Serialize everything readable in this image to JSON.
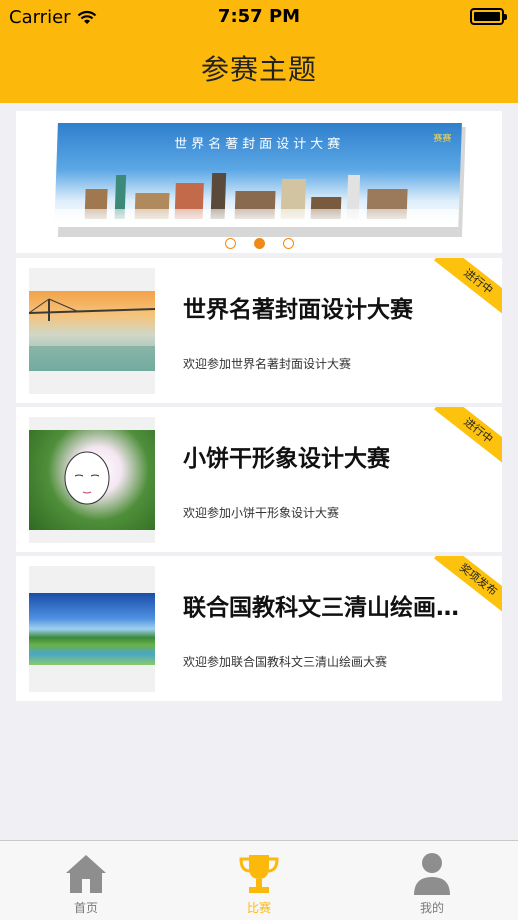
{
  "status": {
    "carrier": "Carrier",
    "time": "7:57 PM"
  },
  "nav": {
    "title": "参赛主题"
  },
  "colors": {
    "accent": "#fcb90c",
    "dot": "#f08a16",
    "background": "#efeff4"
  },
  "banner": {
    "title": "世界名著封面设计大赛",
    "tag": "赛赛",
    "slide_index": 2,
    "slide_count": 3
  },
  "contests": [
    {
      "title": "世界名著封面设计大赛",
      "desc": "欢迎参加世界名著封面设计大赛",
      "status": "进行中",
      "image": "bridge-sunset"
    },
    {
      "title": "小饼干形象设计大赛",
      "desc": "欢迎参加小饼干形象设计大赛",
      "status": "进行中",
      "image": "leaf-girl"
    },
    {
      "title": "联合国教科文三清山绘画…",
      "desc": "欢迎参加联合国教科文三清山绘画大赛",
      "status": "奖项发布",
      "image": "lake-landscape"
    }
  ],
  "tabs": [
    {
      "label": "首页",
      "icon": "home-icon"
    },
    {
      "label": "比赛",
      "icon": "trophy-icon",
      "active": true
    },
    {
      "label": "我的",
      "icon": "user-icon"
    }
  ]
}
